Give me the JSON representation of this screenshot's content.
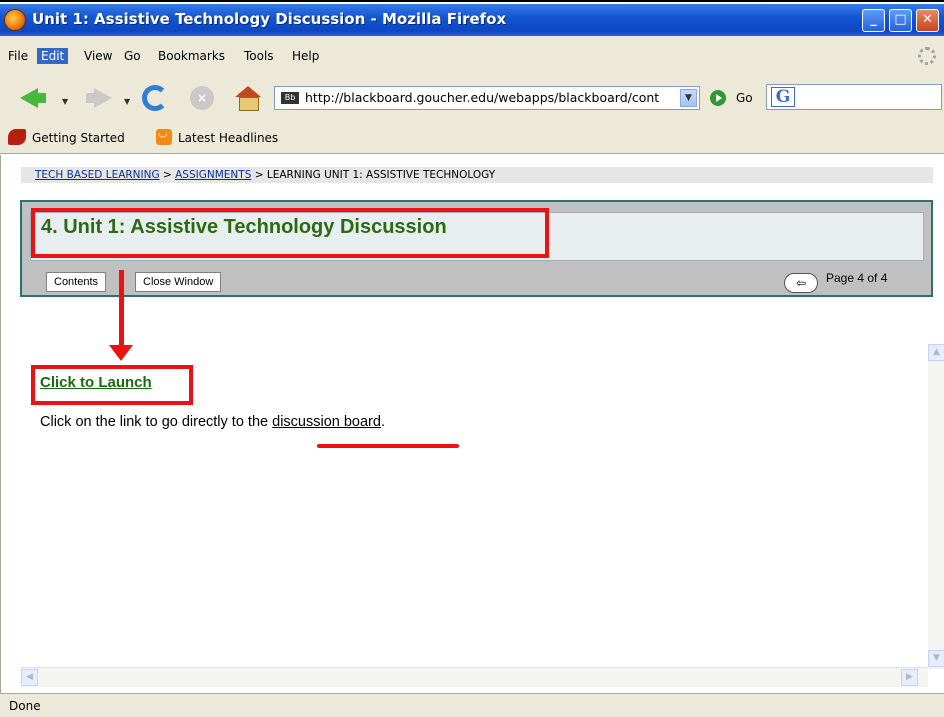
{
  "window": {
    "title": "Unit 1: Assistive Technology Discussion - Mozilla Firefox",
    "minimize_glyph": "_",
    "maximize_glyph": "□",
    "close_glyph": "✕"
  },
  "menu": {
    "items": [
      "File",
      "Edit",
      "View",
      "Go",
      "Bookmarks",
      "Tools",
      "Help"
    ],
    "active": "Edit"
  },
  "navigation": {
    "url": "http://blackboard.goucher.edu/webapps/blackboard/cont",
    "go_label": "Go",
    "search_logo": "G"
  },
  "bookmarks": {
    "items": [
      "Getting Started",
      "Latest Headlines"
    ]
  },
  "page": {
    "breadcrumb": {
      "links": [
        "TECH BASED LEARNING",
        "ASSIGNMENTS"
      ],
      "current": "LEARNING UNIT 1: ASSISTIVE TECHNOLOGY",
      "separator": " > "
    },
    "unit_title": "4. Unit 1: Assistive Technology Discussion",
    "buttons": {
      "contents": "Contents",
      "close_window": "Close Window"
    },
    "page_indicator": "Page 4 of 4",
    "launch_link": "Click to Launch",
    "instruction_prefix": "Click on the link to go directly to the ",
    "instruction_link": "discussion board",
    "instruction_suffix": "."
  },
  "status": {
    "text": "Done"
  },
  "colors": {
    "titlebar": "#0d47c2",
    "annotation_red": "#ee1111",
    "unit_title_green": "#2c6a10",
    "panel_border": "#2c7070"
  }
}
